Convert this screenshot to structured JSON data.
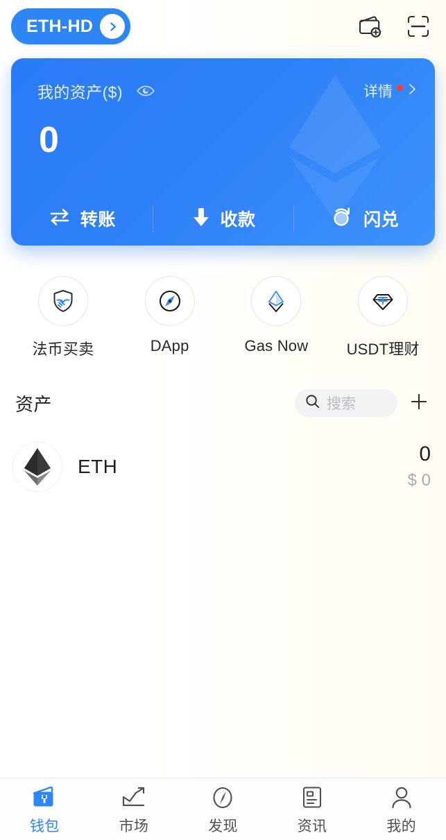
{
  "topbar": {
    "wallet_name": "ETH-HD",
    "wallet_switch_icon": "chevron-right-icon",
    "add_wallet_icon": "wallet-add-icon",
    "scan_icon": "qr-scan-icon"
  },
  "balance_card": {
    "label": "我的资产($)",
    "eye_icon": "eye-icon",
    "detail_label": "详情",
    "detail_chevron_icon": "chevron-right-icon",
    "has_notification_dot": true,
    "amount": "0",
    "watermark_icon": "ethereum-diamond-icon",
    "accent_color": "#2E86F5",
    "dot_color": "#FF3B30",
    "actions": [
      {
        "label": "转账",
        "icon": "transfer-arrows-icon"
      },
      {
        "label": "收款",
        "icon": "arrow-down-icon"
      },
      {
        "label": "闪兑",
        "icon": "swap-circle-icon"
      }
    ]
  },
  "quick_actions": [
    {
      "label": "法币买卖",
      "icon": "shield-handshake-icon"
    },
    {
      "label": "DApp",
      "icon": "compass-icon"
    },
    {
      "label": "Gas Now",
      "icon": "ethereum-outline-icon"
    },
    {
      "label": "USDT理财",
      "icon": "diamond-yuan-icon"
    }
  ],
  "assets": {
    "title": "资产",
    "search_placeholder": "搜索",
    "search_icon": "search-icon",
    "add_icon": "plus-icon",
    "rows": [
      {
        "symbol": "ETH",
        "icon": "ethereum-filled-icon",
        "amount": "0",
        "fiat": "$ 0"
      }
    ]
  },
  "tabbar": {
    "active_index": 0,
    "active_color": "#2E86F5",
    "items": [
      {
        "label": "钱包",
        "icon": "wallet-icon"
      },
      {
        "label": "市场",
        "icon": "chart-trend-icon"
      },
      {
        "label": "发现",
        "icon": "compass-icon"
      },
      {
        "label": "资讯",
        "icon": "news-document-icon"
      },
      {
        "label": "我的",
        "icon": "person-icon"
      }
    ]
  }
}
